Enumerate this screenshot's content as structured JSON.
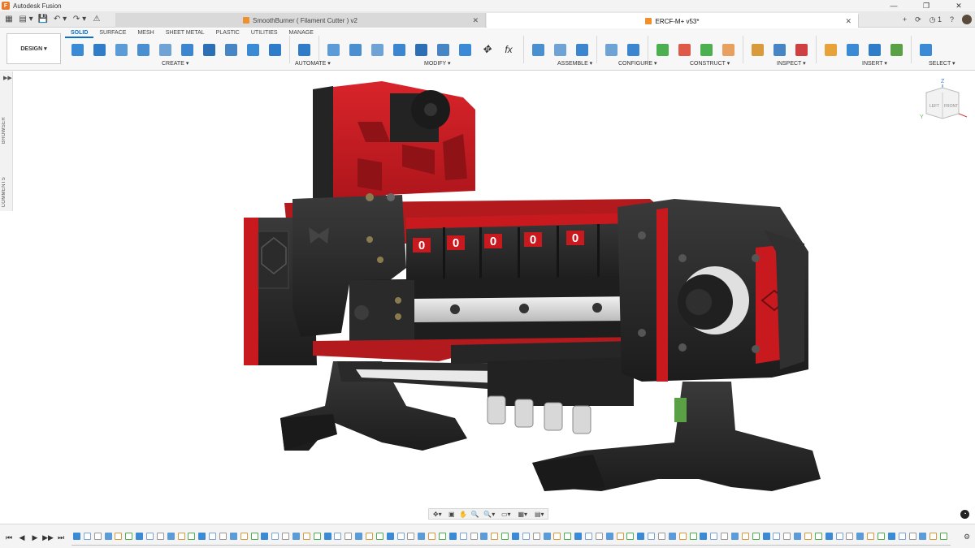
{
  "app": {
    "title": "Autodesk Fusion",
    "window_controls": [
      "—",
      "❐",
      "✕"
    ]
  },
  "quick_access": [
    "▦",
    "▤ ▾",
    "💾",
    "↶ ▾",
    "↷ ▾",
    "⚠"
  ],
  "document_tabs": [
    {
      "label": "SmoothBurner ( Filament Cutter ) v2",
      "active": false
    },
    {
      "label": "ERCF-M+ v53*",
      "active": true
    }
  ],
  "tabrow_right": {
    "add": "+",
    "online": "⟳",
    "jobs": "◷ 1",
    "help": "?"
  },
  "workspace": {
    "label": "DESIGN ▾"
  },
  "ribbon_tabs": [
    {
      "label": "SOLID",
      "active": true
    },
    {
      "label": "SURFACE",
      "active": false
    },
    {
      "label": "MESH",
      "active": false
    },
    {
      "label": "SHEET METAL",
      "active": false
    },
    {
      "label": "PLASTIC",
      "active": false
    },
    {
      "label": "UTILITIES",
      "active": false
    },
    {
      "label": "MANAGE",
      "active": false
    }
  ],
  "tool_groups": [
    {
      "label": "CREATE ▾",
      "tools": [
        "sketch-icon",
        "extrude-icon",
        "revolve-icon",
        "sweep-icon",
        "hole-icon",
        "thread-icon",
        "rib-icon",
        "rectangular-pattern-icon",
        "circular-pattern-icon",
        "mirror-icon"
      ]
    },
    {
      "label": "AUTOMATE ▾",
      "tools": [
        "automate-icon"
      ]
    },
    {
      "label": "MODIFY ▾",
      "tools": [
        "press-pull-icon",
        "fillet-icon",
        "chamfer-icon",
        "shell-icon",
        "combine-icon",
        "scale-icon",
        "align-icon",
        "move-icon",
        "parameters-icon"
      ]
    },
    {
      "label": "ASSEMBLE ▾",
      "tools": [
        "new-component-icon",
        "joint-icon",
        "as-built-joint-icon"
      ]
    },
    {
      "label": "CONFIGURE ▾",
      "tools": [
        "configure-icon",
        "table-icon"
      ]
    },
    {
      "label": "CONSTRUCT ▾",
      "tools": [
        "offset-plane-icon",
        "midplane-icon",
        "axis-icon",
        "point-icon"
      ]
    },
    {
      "label": "INSPECT ▾",
      "tools": [
        "measure-icon",
        "interference-icon",
        "section-analysis-icon"
      ]
    },
    {
      "label": "INSERT ▾",
      "tools": [
        "insert-mcmaster-icon",
        "insert-image-icon",
        "insert-mesh-icon",
        "insert-manufacturer-icon"
      ]
    },
    {
      "label": "SELECT ▾",
      "tools": [
        "select-icon"
      ]
    }
  ],
  "left_panel": {
    "browser": "BROWSER",
    "comments": "COMMENTS"
  },
  "viewcube": {
    "left": "LEFT",
    "front": "FRONT",
    "z": "Z",
    "y": "Y"
  },
  "counter_digits": [
    "0",
    "0",
    "0",
    "0",
    "0"
  ],
  "navbar": [
    "✥▾",
    "▣",
    "✋",
    "🔍",
    "🔍▾",
    "▭▾",
    "▦▾",
    "▤▾"
  ],
  "timeline": {
    "controls": [
      "⏮",
      "◀",
      "▶",
      "▶▶",
      "⏭"
    ],
    "feature_count": 84,
    "end_icon": "⚙"
  },
  "colors": {
    "accent": "#0b6fc5",
    "body_red": "#c8191e",
    "body_black": "#252525",
    "tab_cube": "#f0902c"
  }
}
